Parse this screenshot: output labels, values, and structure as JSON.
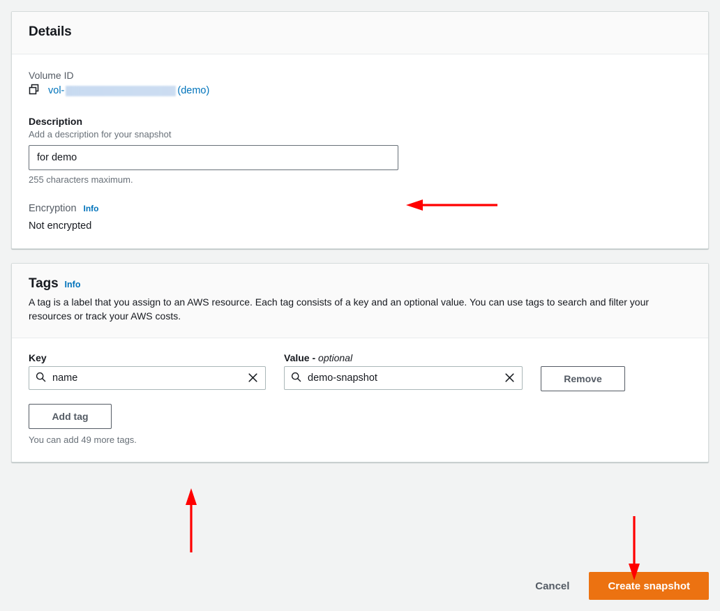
{
  "details": {
    "title": "Details",
    "volume_id": {
      "label": "Volume ID",
      "prefix": "vol-",
      "suffix": "(demo)",
      "copy_icon": "copy-icon"
    },
    "description": {
      "label": "Description",
      "hint": "Add a description for your snapshot",
      "value": "for demo",
      "constraint": "255 characters maximum."
    },
    "encryption": {
      "label": "Encryption",
      "info_label": "Info",
      "value": "Not encrypted"
    }
  },
  "tags": {
    "title": "Tags",
    "info_label": "Info",
    "description": "A tag is a label that you assign to an AWS resource. Each tag consists of a key and an optional value. You can use tags to search and filter your resources or track your AWS costs.",
    "columns": {
      "key": "Key",
      "value_main": "Value - ",
      "value_optional": "optional"
    },
    "rows": [
      {
        "key": "name",
        "value": "demo-snapshot",
        "remove_label": "Remove",
        "search_icon": "search-icon",
        "clear_icon": "close-icon"
      }
    ],
    "add_tag_label": "Add tag",
    "tags_remaining": "You can add 49 more tags."
  },
  "footer": {
    "cancel_label": "Cancel",
    "submit_label": "Create snapshot"
  },
  "colors": {
    "accent_orange": "#ec7211",
    "link_blue": "#0073bb",
    "annotation_red": "#ff0000",
    "page_background": "#f2f3f3"
  }
}
